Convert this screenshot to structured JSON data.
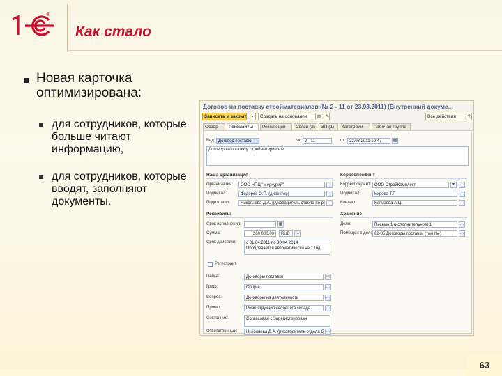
{
  "brand": {
    "logo_text": "1С",
    "registered_mark": "®"
  },
  "slide": {
    "title": "Как стало",
    "main_bullet": "Новая карточка оптимизирована:",
    "sub_bullets": [
      "для сотрудников, которые больше читают информацию,",
      "для сотрудников, которые вводят, заполняют документы."
    ],
    "page_number": "63"
  },
  "form": {
    "title": "Договор на поставку стройматериалов (№ 2 - 11 от 23.03.2011) (Внутренний докуме...",
    "toolbar": {
      "save_close": "Записать и закрыть",
      "create_based": "Создать на основании",
      "all_actions": "Все действия"
    },
    "tabs": [
      "Обзор",
      "Реквизиты",
      "Резолюции",
      "Связи (3)",
      "ЭП (1)",
      "Категории",
      "Рабочая группа"
    ],
    "active_tab": "Реквизиты",
    "header": {
      "kind_label": "Вид:",
      "kind_value": "Договор поставки",
      "number_label": "№:",
      "number_value": "2 - 11",
      "date_label": "от:",
      "date_value": "23.03.2011 10:47",
      "name_value": "Договор на поставку стройматериалов"
    },
    "our_org": {
      "section": "Наша организация",
      "org_label": "Организация:",
      "org_value": "ООО НПЦ \"Меркурий\"",
      "signer_label": "Подписал:",
      "signer_value": "Федоров О.П. (директор)",
      "preparer_label": "Подготовил:",
      "preparer_value": "Николаева Д.А. (руководитель отдела по работе с"
    },
    "correspondent": {
      "section": "Корреспондент",
      "corr_label": "Корреспондент:",
      "corr_value": "ООО СтройКомплект",
      "signer_label": "Подписал:",
      "signer_value": "Кирова Т.Г.",
      "contact_label": "Контакт:",
      "contact_value": "Кельцева А.Ц."
    },
    "requisites": {
      "section": "Реквизиты",
      "term_label": "Срок исполнения:",
      "sum_label": "Сумма:",
      "sum_value": "260 000,00",
      "currency_value": "RUB",
      "validity_label": "Срок действия:",
      "validity_value": "с 01.04.2011 по 30.04.2014",
      "validity_note": "Продлевается автоматически на 1 год",
      "tracked_label": "Регистрант",
      "folder_label": "Папка:",
      "folder_value": "Договоры поставки",
      "stamp_label": "Гриф:",
      "stamp_value": "Общие",
      "question_label": "Вопрос:",
      "question_value": "Договоры на деятельность",
      "project_label": "Проект:",
      "project_value": "Реконструкция холодного склада",
      "state_label": "Состояние:",
      "state_value": "Согласован с Зарегистрирован",
      "responsible_label": "Ответственный:",
      "responsible_value": "Николаева Д.А. (руководитель отдела ОК)"
    },
    "storage": {
      "section": "Хранение",
      "case_label": "Дело:",
      "case_value": "Письмо 1 (исполнительное) 1",
      "placed_label": "Помещен в дело:",
      "placed_value": "02-05 Договоры поставки (том № )"
    }
  }
}
